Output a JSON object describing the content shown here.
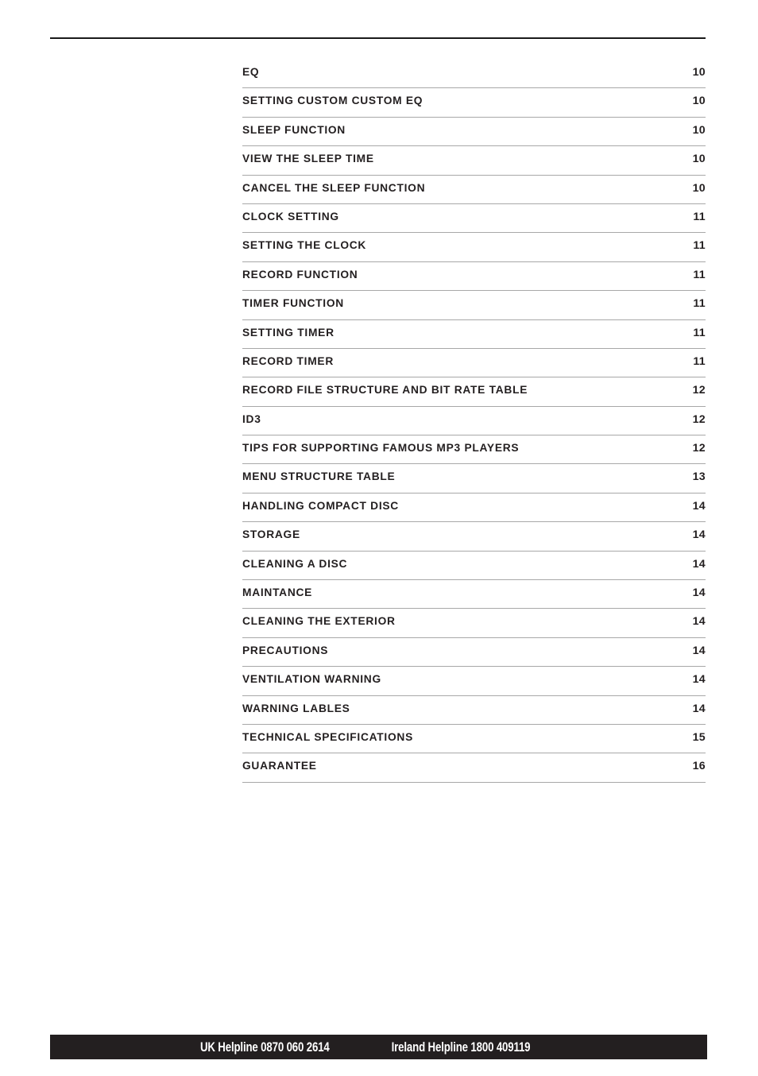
{
  "document": {
    "type": "table-of-contents",
    "page_background": "#ffffff",
    "text_color": "#231f20",
    "rule_color": "#a8a8a8",
    "top_rule_color": "#1a1a1a"
  },
  "toc": {
    "entries": [
      {
        "title": "EQ",
        "page": "10"
      },
      {
        "title": "SETTING CUSTOM CUSTOM EQ",
        "page": "10"
      },
      {
        "title": "SLEEP FUNCTION",
        "page": "10"
      },
      {
        "title": "VIEW THE SLEEP TIME",
        "page": "10"
      },
      {
        "title": "CANCEL THE SLEEP FUNCTION",
        "page": "10"
      },
      {
        "title": "CLOCK SETTING",
        "page": "11"
      },
      {
        "title": "SETTING THE CLOCK",
        "page": "11"
      },
      {
        "title": "RECORD FUNCTION",
        "page": "11"
      },
      {
        "title": "TIMER FUNCTION",
        "page": "11"
      },
      {
        "title": "SETTING TIMER",
        "page": "11"
      },
      {
        "title": "RECORD TIMER",
        "page": "11"
      },
      {
        "title": "RECORD FILE STRUCTURE AND BIT RATE TABLE",
        "page": "12"
      },
      {
        "title": "ID3",
        "page": "12"
      },
      {
        "title": "TIPS FOR SUPPORTING FAMOUS MP3 PLAYERS",
        "page": "12"
      },
      {
        "title": "MENU STRUCTURE TABLE",
        "page": "13"
      },
      {
        "title": "HANDLING COMPACT DISC",
        "page": "14"
      },
      {
        "title": "STORAGE",
        "page": "14"
      },
      {
        "title": "CLEANING A DISC",
        "page": "14"
      },
      {
        "title": "MAINTANCE",
        "page": "14"
      },
      {
        "title": "CLEANING THE EXTERIOR",
        "page": "14"
      },
      {
        "title": "PRECAUTIONS",
        "page": "14"
      },
      {
        "title": "VENTILATION WARNING",
        "page": "14"
      },
      {
        "title": "WARNING LABLES",
        "page": "14"
      },
      {
        "title": "TECHNICAL SPECIFICATIONS",
        "page": "15"
      },
      {
        "title": "GUARANTEE",
        "page": "16"
      }
    ]
  },
  "footer": {
    "background_color": "#231f20",
    "text_color": "#ffffff",
    "uk_helpline": "UK Helpline 0870 060 2614",
    "ireland_helpline": "Ireland Helpline 1800 409119"
  }
}
